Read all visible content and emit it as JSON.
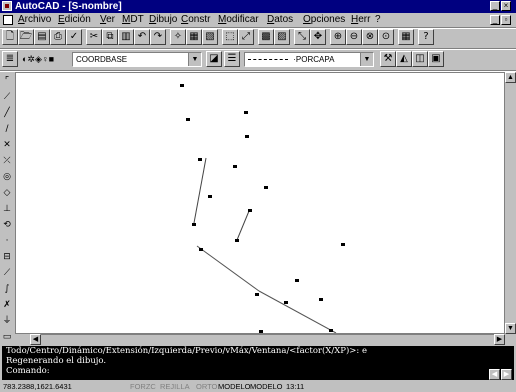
{
  "window": {
    "title": "AutoCAD - [S-nombre]"
  },
  "menubar": {
    "items": [
      "Archivo",
      "Edición",
      "Ver",
      "MDT",
      "Dibujo",
      "Constr",
      "Modificar",
      "Datos",
      "Opciones",
      "Herr",
      "?"
    ]
  },
  "toolbar2": {
    "layer_value": "COORDBASE",
    "linetype_value": "·PORCAPA"
  },
  "command_window": {
    "lines": [
      "Todo/Centro/Dinámico/Extensión/Izquierda/Previo/vMáx/Ventana/<factor(X/XP)>: e",
      "Regenerando el dibujo.",
      "Comando:"
    ]
  },
  "statusbar": {
    "coords": "783.2388,1621.6431",
    "forzc": "FORZC",
    "rejilla": "REJILLA",
    "orto": "ORTO",
    "modelo": "MODELO",
    "modelo_tab": "MODELO",
    "time": "13:11"
  },
  "colors": {
    "titlebar": "#000080",
    "face": "#c0c0c0",
    "command_bg": "#000000",
    "command_fg": "#ffffff"
  },
  "icons": {
    "left_tools": [
      "line-icon",
      "polyline-icon",
      "arc-icon",
      "line-icon",
      "cross-icon",
      "cross-icon",
      "circle-icon",
      "polygon-icon",
      "point-icon",
      "rotate-icon",
      "dot-icon",
      "rectangle-icon",
      "edit-icon",
      "curve-icon",
      "x-icon",
      "pin-icon",
      "page-icon"
    ]
  }
}
